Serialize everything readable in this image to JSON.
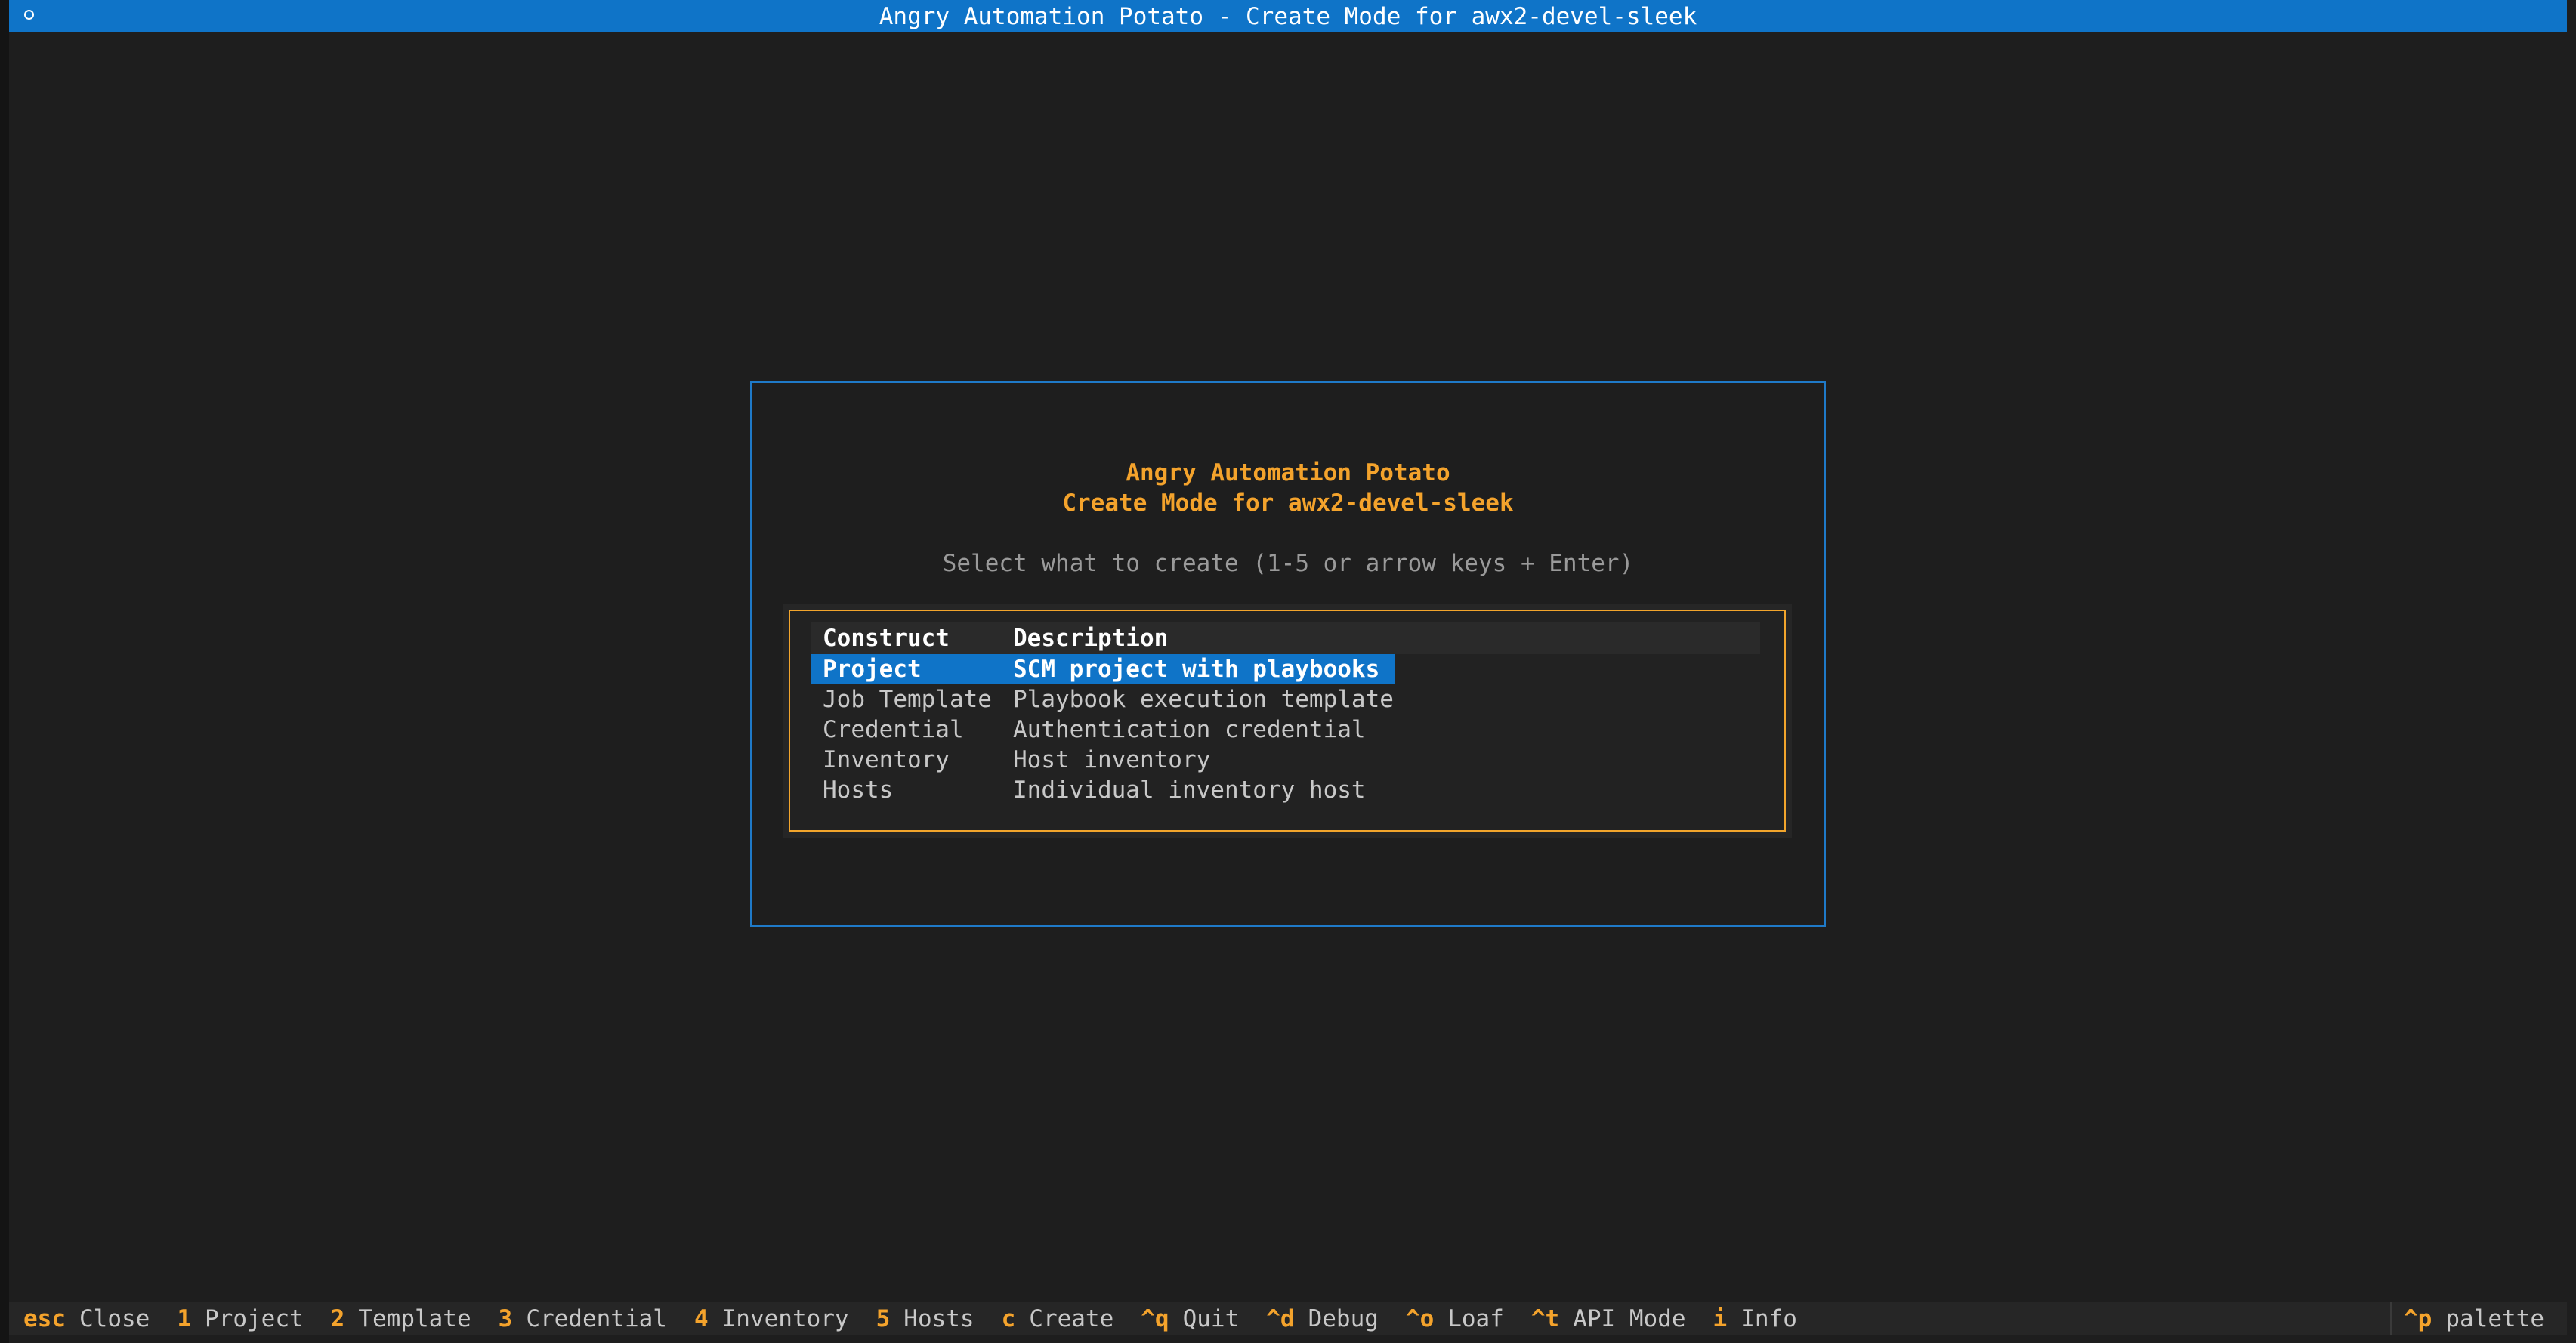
{
  "window": {
    "title": "Angry Automation Potato - Create Mode for awx2-devel-sleek"
  },
  "dialog": {
    "heading_line1": "Angry Automation Potato",
    "heading_line2": "Create Mode for awx2-devel-sleek",
    "hint": "Select what to create (1-5 or arrow keys + Enter)",
    "table": {
      "columns": [
        "Construct",
        "Description"
      ],
      "rows": [
        {
          "construct": "Project",
          "description": "SCM project with playbooks",
          "selected": true
        },
        {
          "construct": "Job Template",
          "description": "Playbook execution template",
          "selected": false
        },
        {
          "construct": "Credential",
          "description": "Authentication credential",
          "selected": false
        },
        {
          "construct": "Inventory",
          "description": "Host inventory",
          "selected": false
        },
        {
          "construct": "Hosts",
          "description": "Individual inventory host",
          "selected": false
        }
      ]
    }
  },
  "footer": {
    "bindings": [
      {
        "key": "esc",
        "label": "Close"
      },
      {
        "key": "1",
        "label": "Project"
      },
      {
        "key": "2",
        "label": "Template"
      },
      {
        "key": "3",
        "label": "Credential"
      },
      {
        "key": "4",
        "label": "Inventory"
      },
      {
        "key": "5",
        "label": "Hosts"
      },
      {
        "key": "c",
        "label": "Create"
      },
      {
        "key": "^q",
        "label": "Quit"
      },
      {
        "key": "^d",
        "label": "Debug"
      },
      {
        "key": "^o",
        "label": "Loaf"
      },
      {
        "key": "^t",
        "label": "API Mode"
      },
      {
        "key": "i",
        "label": "Info"
      }
    ],
    "palette": {
      "key": "^p",
      "label": "palette"
    }
  },
  "colors": {
    "accent_blue": "#0f74c8",
    "accent_orange": "#f4a32c",
    "background": "#1e1e1e"
  }
}
